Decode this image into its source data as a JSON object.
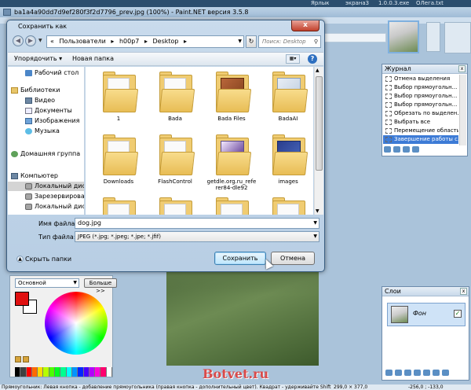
{
  "taskbar": {
    "items": [
      "Ярлык",
      "экрана3",
      "1.0.0.3.exe",
      "ОЛега.txt"
    ]
  },
  "paintnet": {
    "title": "ba1a4a90dd7d9ef280f3f2d7796_prev.jpg (100%) - Paint.NET версия 3.5.8"
  },
  "palette": {
    "mode": "Основной",
    "more_button": "Больше >>",
    "primary_color": "#e01010",
    "secondary_color": "#ffffff",
    "swatches": [
      "#000000",
      "#404040",
      "#ff0000",
      "#ff6a00",
      "#ffd800",
      "#b6ff00",
      "#4cff00",
      "#00ff21",
      "#00ff90",
      "#00ffff",
      "#0094ff",
      "#0026ff",
      "#4800ff",
      "#b200ff",
      "#ff00dc",
      "#ff006e",
      "#ffffff"
    ]
  },
  "history": {
    "title": "Журнал",
    "items": [
      "Отмена выделения",
      "Выбор прямоугольн...",
      "Выбор прямоугольн...",
      "Выбор прямоугольн...",
      "Обрезать по выделен...",
      "Выбрать все",
      "Перемещение области",
      "Завершение работы с..."
    ],
    "selected_index": 7
  },
  "layers": {
    "title": "Слои",
    "layer_name": "Фон",
    "visible": true
  },
  "statusbar": {
    "hint": "Прямоугольник: Левая кнопка - добавление прямоугольника (правая кнопка - дополнительный цвет). Квадрат - удерживайте Shift",
    "size": "299,0 × 377,0",
    "coords": "-256,0 ; -133,0"
  },
  "watermark": "Botvet.ru",
  "dialog": {
    "title": "Сохранить как",
    "close_label": "x",
    "address": {
      "segments": [
        "«",
        "Пользователи",
        "▸",
        "h00p7",
        "▸",
        "Desktop",
        "▸"
      ]
    },
    "search_placeholder": "Поиск: Desktop",
    "toolbar": {
      "organize": "Упорядочить ▾",
      "new_folder": "Новая папка"
    },
    "nav_items": [
      {
        "label": "Рабочий стол",
        "icon": "desktop-icon"
      },
      {
        "label": "Библиотеки",
        "icon": "library-icon"
      },
      {
        "label": "Видео",
        "icon": "video-icon"
      },
      {
        "label": "Документы",
        "icon": "documents-icon"
      },
      {
        "label": "Изображения",
        "icon": "pictures-icon"
      },
      {
        "label": "Музыка",
        "icon": "music-icon"
      },
      {
        "label": "Домашняя группа",
        "icon": "homegroup-icon"
      },
      {
        "label": "Компьютер",
        "icon": "computer-icon"
      },
      {
        "label": "Локальный диск",
        "icon": "disk-icon"
      },
      {
        "label": "Зарезервировано",
        "icon": "disk-icon"
      },
      {
        "label": "Локальный диск",
        "icon": "disk-icon"
      }
    ],
    "files": [
      {
        "label": "1",
        "kind": "folder"
      },
      {
        "label": "Bada",
        "kind": "folder"
      },
      {
        "label": "Bada Files",
        "kind": "bada-files"
      },
      {
        "label": "BadaAI",
        "kind": "badaai"
      },
      {
        "label": "Downloads",
        "kind": "folder"
      },
      {
        "label": "FlashControl",
        "kind": "folder"
      },
      {
        "label": "getdle.org.ru_refe rer84-dle92",
        "kind": "getdle"
      },
      {
        "label": "images",
        "kind": "images"
      },
      {
        "label": "",
        "kind": "folder"
      },
      {
        "label": "",
        "kind": "folder"
      },
      {
        "label": "",
        "kind": "folder"
      },
      {
        "label": "",
        "kind": "folder"
      }
    ],
    "file_name_label": "Имя файла:",
    "file_name_value": "dog.jpg",
    "file_type_label": "Тип файла:",
    "file_type_value": "JPEG (*.jpg; *.jpeg; *.jpe; *.jfif)",
    "hide_folders": "Скрыть папки",
    "save_button": "Сохранить",
    "cancel_button": "Отмена"
  }
}
